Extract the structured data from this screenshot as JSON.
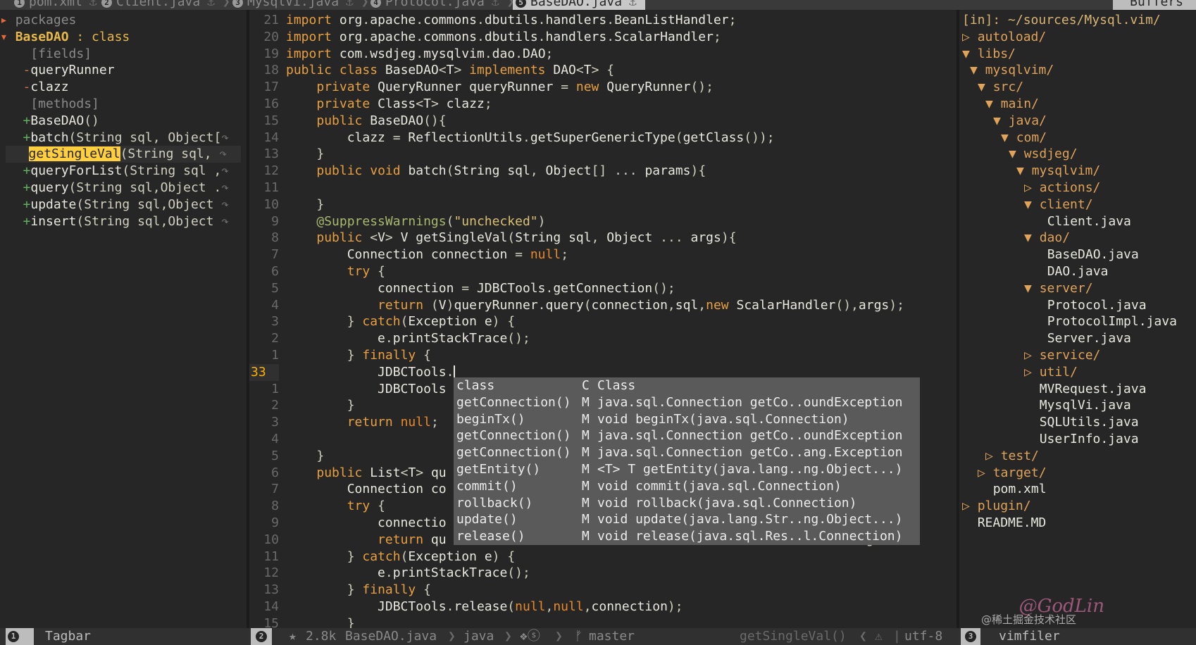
{
  "tabs": [
    {
      "num": "1",
      "label": "pom.xml"
    },
    {
      "num": "2",
      "label": "Client.java"
    },
    {
      "num": "3",
      "label": "MysqlVi.java"
    },
    {
      "num": "4",
      "label": "Protocol.java"
    },
    {
      "num": "5",
      "label": "BaseDAO.java",
      "active": true
    }
  ],
  "buffers_label": "Buffers",
  "tagbar": {
    "packages": "packages",
    "class_name": "BaseDAO",
    "class_kind": " : class",
    "fields_label": "[fields]",
    "fields": [
      "queryRunner",
      "clazz"
    ],
    "methods_label": "[methods]",
    "methods": [
      {
        "name": "BaseDAO",
        "sig": "()"
      },
      {
        "name": "batch",
        "sig": "(String sql, Object["
      },
      {
        "name": "getSingleVal",
        "sig": "(String sql, "
      },
      {
        "name": "queryForList",
        "sig": "(String sql ,"
      },
      {
        "name": "query",
        "sig": "(String sql,Object ."
      },
      {
        "name": "update",
        "sig": "(String sql,Object "
      },
      {
        "name": "insert",
        "sig": "(String sql,Object "
      }
    ]
  },
  "editor": {
    "lines": [
      {
        "n": "21",
        "code": "import org.apache.commons.dbutils.handlers.BeanListHandler;"
      },
      {
        "n": "20",
        "code": "import org.apache.commons.dbutils.handlers.ScalarHandler;"
      },
      {
        "n": "19",
        "code": "import com.wsdjeg.mysqlvim.dao.DAO;"
      },
      {
        "n": "18",
        "code": "public class BaseDAO<T> implements DAO<T> {"
      },
      {
        "n": "17",
        "code": "    private QueryRunner queryRunner = new QueryRunner();"
      },
      {
        "n": "16",
        "code": "    private Class<T> clazz;"
      },
      {
        "n": "15",
        "code": "    public BaseDAO(){"
      },
      {
        "n": "14",
        "code": "        clazz = ReflectionUtils.getSuperGenericType(getClass());"
      },
      {
        "n": "13",
        "code": "    }"
      },
      {
        "n": "12",
        "code": "    public void batch(String sql, Object[] ... params){"
      },
      {
        "n": "11",
        "code": ""
      },
      {
        "n": "10",
        "code": "    }"
      },
      {
        "n": "9",
        "code": "    @SuppressWarnings(\"unchecked\")"
      },
      {
        "n": "8",
        "code": "    public <V> V getSingleVal(String sql, Object ... args){"
      },
      {
        "n": "7",
        "code": "        Connection connection = null;"
      },
      {
        "n": "6",
        "code": "        try {"
      },
      {
        "n": "5",
        "code": "            connection = JDBCTools.getConnection();"
      },
      {
        "n": "4",
        "code": "            return (V)queryRunner.query(connection,sql,new ScalarHandler(),args);"
      },
      {
        "n": "3",
        "code": "        } catch(Exception e) {"
      },
      {
        "n": "2",
        "code": "            e.printStackTrace();"
      },
      {
        "n": "1",
        "code": "        } finally {"
      },
      {
        "n": "33",
        "code": "            JDBCTools.",
        "current": true
      },
      {
        "n": "1",
        "code": "            JDBCTools"
      },
      {
        "n": "2",
        "code": "        }"
      },
      {
        "n": "3",
        "code": "        return null;"
      },
      {
        "n": "4",
        "code": ""
      },
      {
        "n": "5",
        "code": "    }"
      },
      {
        "n": "6",
        "code": "    public List<T> qu"
      },
      {
        "n": "7",
        "code": "        Connection co"
      },
      {
        "n": "8",
        "code": "        try {"
      },
      {
        "n": "9",
        "code": "            connectio"
      },
      {
        "n": "10",
        "code": "            return qu",
        "tail": "arg"
      },
      {
        "n": "11",
        "code": "        } catch(Exception e) {"
      },
      {
        "n": "12",
        "code": "            e.printStackTrace();"
      },
      {
        "n": "13",
        "code": "        } finally {"
      },
      {
        "n": "14",
        "code": "            JDBCTools.release(null,null,connection);"
      },
      {
        "n": "15",
        "code": "        }"
      }
    ]
  },
  "completion": [
    {
      "word": "class",
      "kind": "C",
      "menu": "Class"
    },
    {
      "word": "getConnection()",
      "kind": "M",
      "menu": "java.sql.Connection getCo..oundException"
    },
    {
      "word": "beginTx()",
      "kind": "M",
      "menu": "void beginTx(java.sql.Connection)"
    },
    {
      "word": "getConnection()",
      "kind": "M",
      "menu": "java.sql.Connection getCo..oundException"
    },
    {
      "word": "getConnection()",
      "kind": "M",
      "menu": "java.sql.Connection getCo..ang.Exception"
    },
    {
      "word": "getEntity()",
      "kind": "M",
      "menu": "<T> T getEntity(java.lang..ng.Object...)"
    },
    {
      "word": "commit()",
      "kind": "M",
      "menu": "void commit(java.sql.Connection)"
    },
    {
      "word": "rollback()",
      "kind": "M",
      "menu": "void rollback(java.sql.Connection)"
    },
    {
      "word": "update()",
      "kind": "M",
      "menu": "void update(java.lang.Str..ng.Object...)"
    },
    {
      "word": "release()",
      "kind": "M",
      "menu": "void release(java.sql.Res..l.Connection)"
    }
  ],
  "filer": {
    "header": "[in]: ~/sources/Mysql.vim/",
    "items": [
      {
        "depth": 0,
        "arrow": "▷",
        "name": "autoload/",
        "dir": true
      },
      {
        "depth": 0,
        "arrow": "▼",
        "name": "libs/",
        "dir": true
      },
      {
        "depth": 1,
        "arrow": "▼",
        "name": "mysqlvim/",
        "dir": true
      },
      {
        "depth": 2,
        "arrow": "▼",
        "name": "src/",
        "dir": true
      },
      {
        "depth": 3,
        "arrow": "▼",
        "name": "main/",
        "dir": true
      },
      {
        "depth": 4,
        "arrow": "▼",
        "name": "java/",
        "dir": true
      },
      {
        "depth": 5,
        "arrow": "▼",
        "name": "com/",
        "dir": true
      },
      {
        "depth": 6,
        "arrow": "▼",
        "name": "wsdjeg/",
        "dir": true
      },
      {
        "depth": 7,
        "arrow": "▼",
        "name": "mysqlvim/",
        "dir": true
      },
      {
        "depth": 8,
        "arrow": "▷",
        "name": "actions/",
        "dir": true
      },
      {
        "depth": 8,
        "arrow": "▼",
        "name": "client/",
        "dir": true
      },
      {
        "depth": 9,
        "arrow": "",
        "name": "Client.java",
        "dir": false
      },
      {
        "depth": 8,
        "arrow": "▼",
        "name": "dao/",
        "dir": true
      },
      {
        "depth": 9,
        "arrow": "",
        "name": "BaseDAO.java",
        "dir": false
      },
      {
        "depth": 9,
        "arrow": "",
        "name": "DAO.java",
        "dir": false
      },
      {
        "depth": 8,
        "arrow": "▼",
        "name": "server/",
        "dir": true
      },
      {
        "depth": 9,
        "arrow": "",
        "name": "Protocol.java",
        "dir": false
      },
      {
        "depth": 9,
        "arrow": "",
        "name": "ProtocolImpl.java",
        "dir": false
      },
      {
        "depth": 9,
        "arrow": "",
        "name": "Server.java",
        "dir": false
      },
      {
        "depth": 8,
        "arrow": "▷",
        "name": "service/",
        "dir": true
      },
      {
        "depth": 8,
        "arrow": "▷",
        "name": "util/",
        "dir": true
      },
      {
        "depth": 8,
        "arrow": "",
        "name": "MVRequest.java",
        "dir": false
      },
      {
        "depth": 8,
        "arrow": "",
        "name": "MysqlVi.java",
        "dir": false
      },
      {
        "depth": 8,
        "arrow": "",
        "name": "SQLUtils.java",
        "dir": false
      },
      {
        "depth": 8,
        "arrow": "",
        "name": "UserInfo.java",
        "dir": false
      },
      {
        "depth": 3,
        "arrow": "▷",
        "name": "test/",
        "dir": true
      },
      {
        "depth": 2,
        "arrow": "▷",
        "name": "target/",
        "dir": true
      },
      {
        "depth": 2,
        "arrow": "",
        "name": "pom.xml",
        "dir": false
      },
      {
        "depth": 0,
        "arrow": "▷",
        "name": "plugin/",
        "dir": true
      },
      {
        "depth": 0,
        "arrow": "",
        "name": "README.MD",
        "dir": false
      }
    ]
  },
  "statusbar": {
    "left_num": "1",
    "left_label": "Tagbar",
    "mid_num": "2",
    "mid_star": "★",
    "mid_size": "2.8k",
    "mid_file": "BaseDAO.java",
    "filetype": "java",
    "symbols": "❖ⓢ",
    "branch_icon": "ᚠ",
    "branch": "master",
    "func": "getSingleVal()",
    "warn_icon": "⚠",
    "encoding": "utf-8",
    "right_num": "3",
    "right_label": "vimfiler"
  },
  "watermark": "@GodLin",
  "watermark_sub": "@稀土掘金技术社区"
}
